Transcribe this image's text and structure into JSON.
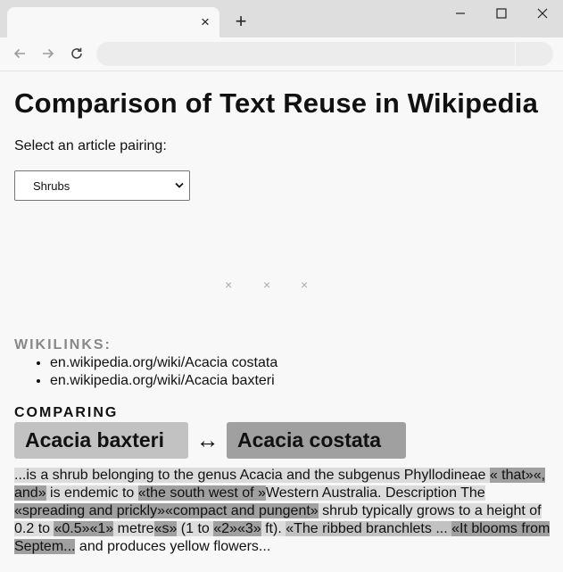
{
  "browser": {
    "tab_close": "×",
    "new_tab": "+"
  },
  "page": {
    "title": "Comparison of Text Reuse in Wikipedia",
    "select_label": "Select an article pairing:",
    "select_value": "Shrubs",
    "loading_marks": [
      "×",
      "×",
      "×"
    ],
    "wikilinks_heading": "WIKILINKS:",
    "links": [
      "en.wikipedia.org/wiki/Acacia costata",
      "en.wikipedia.org/wiki/Acacia baxteri"
    ],
    "comparing_heading": "COMPARING",
    "article_left": "Acacia baxteri",
    "arrow": "↔",
    "article_right": "Acacia costata"
  },
  "passage": [
    {
      "t": "...is a shrub belonging to the genus Acacia and the subgenus Phyllodineae ",
      "hl": "3"
    },
    {
      "t": "« that»«, and»",
      "hl": "2"
    },
    {
      "t": " is endemic to ",
      "hl": "3"
    },
    {
      "t": "«the south west of »",
      "hl": "2"
    },
    {
      "t": "Western Australia. Description The ",
      "hl": "3"
    },
    {
      "t": "«spreading and prickly»«compact and pungent»",
      "hl": "2"
    },
    {
      "t": " shrub typically grows to a height of 0.2 to ",
      "hl": "3"
    },
    {
      "t": "«0.5»«1»",
      "hl": "2"
    },
    {
      "t": " metre",
      "hl": "3"
    },
    {
      "t": "«s»",
      "hl": "2"
    },
    {
      "t": " (1 to ",
      "hl": "3"
    },
    {
      "t": "«2»«3»",
      "hl": "2"
    },
    {
      "t": " ft). ",
      "hl": "3"
    },
    {
      "t": "«The ribbed branchlets ... ",
      "hl": "1"
    },
    {
      "t": "«It blooms from Septem...",
      "hl": "2"
    },
    {
      "t": "  and produces yellow flowers...",
      "hl": "0"
    }
  ]
}
